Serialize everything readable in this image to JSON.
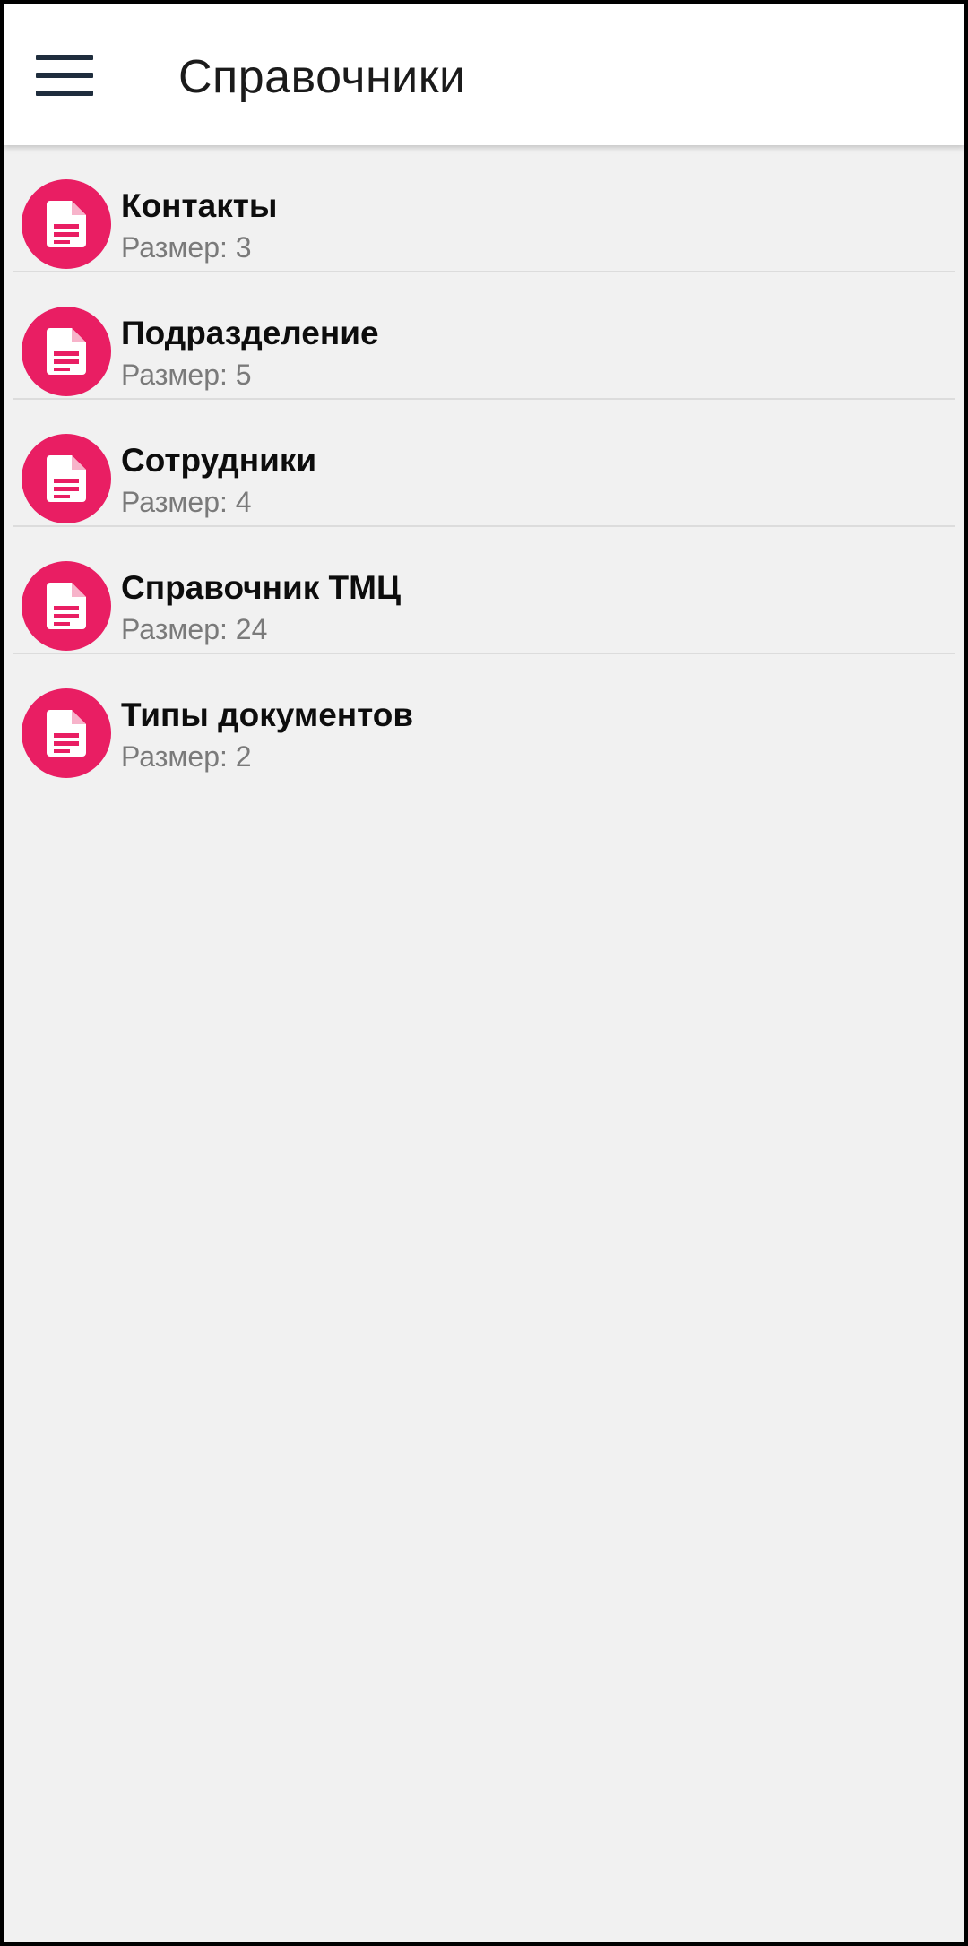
{
  "header": {
    "title": "Справочники",
    "menu_icon": "hamburger-menu-icon"
  },
  "colors": {
    "accent": "#e91e63",
    "menu_icon": "#1f2d3d",
    "background": "#f1f1f1"
  },
  "list": {
    "items": [
      {
        "title": "Контакты",
        "subtitle": "Размер: 3",
        "icon": "document-icon"
      },
      {
        "title": "Подразделение",
        "subtitle": "Размер: 5",
        "icon": "document-icon"
      },
      {
        "title": "Сотрудники",
        "subtitle": "Размер: 4",
        "icon": "document-icon"
      },
      {
        "title": "Справочник ТМЦ",
        "subtitle": "Размер: 24",
        "icon": "document-icon"
      },
      {
        "title": "Типы документов",
        "subtitle": "Размер: 2",
        "icon": "document-icon"
      }
    ]
  }
}
